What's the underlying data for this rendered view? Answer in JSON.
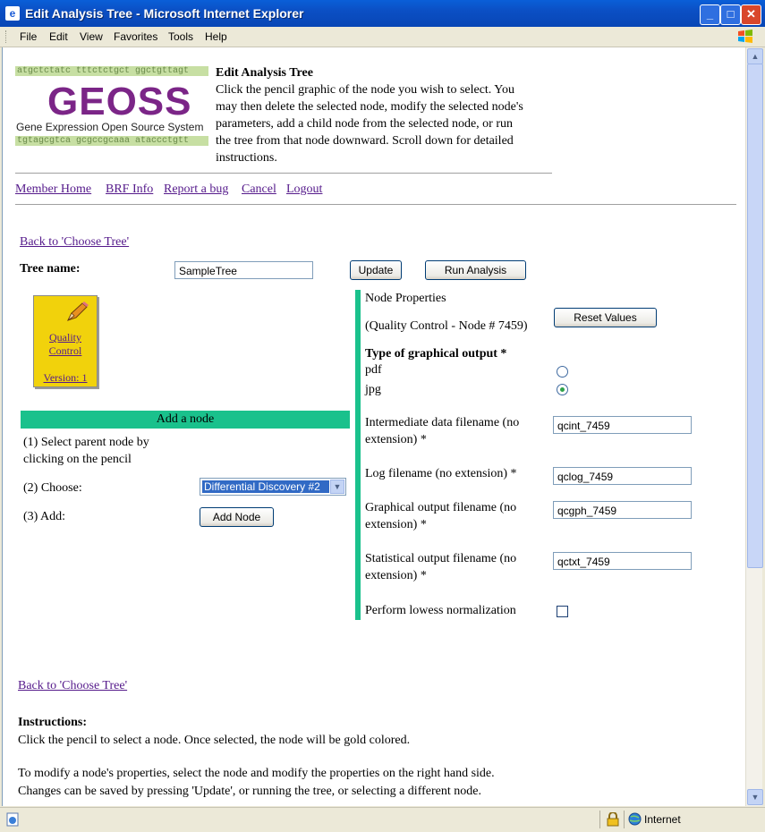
{
  "window": {
    "title": "Edit Analysis Tree - Microsoft Internet Explorer",
    "menu": [
      "File",
      "Edit",
      "View",
      "Favorites",
      "Tools",
      "Help"
    ]
  },
  "header": {
    "seq_top": "atgctctatc tttctctgct ggctgttagt",
    "logo": "GEOSS",
    "logo_sub": "Gene Expression Open Source System",
    "seq_bottom": "tgtagcgtca gcgccgcaaa ataccctgtt",
    "intro_title": "Edit Analysis Tree",
    "intro_lines": [
      "Click the pencil graphic of the node you wish to select. You",
      "may then delete the selected node, modify the selected node's",
      "parameters, add a child node from the selected node, or run",
      "the tree from that node downward. Scroll down for detailed",
      "instructions."
    ]
  },
  "nav": [
    "Member Home",
    "BRF Info",
    "Report a bug",
    "Cancel",
    "Logout"
  ],
  "back_link": "Back to 'Choose Tree'",
  "tree": {
    "name_label": "Tree name:",
    "name_value": "SampleTree",
    "update_label": "Update",
    "run_label": "Run Analysis"
  },
  "node": {
    "line1": "Quality",
    "line2": "Control",
    "version": "Version: 1"
  },
  "add_node": {
    "title": "Add a node",
    "step1a": "(1) Select parent node by",
    "step1b": "clicking on the pencil",
    "step2": "(2) Choose:",
    "choose_value": "Differential Discovery #2",
    "step3": "(3) Add:",
    "add_button": "Add Node"
  },
  "props": {
    "heading": "Node Properties",
    "subheading": "(Quality Control - Node # 7459)",
    "reset_label": "Reset Values",
    "output_type_label": "Type of graphical output *",
    "pdf_label": "pdf",
    "jpg_label": "jpg",
    "intermediate_label_1": "Intermediate data filename (no",
    "intermediate_label_2": "extension) *",
    "intermediate_value": "qcint_7459",
    "log_label": "Log filename (no extension) *",
    "log_value": "qclog_7459",
    "graph_label_1": "Graphical output filename (no",
    "graph_label_2": "extension) *",
    "graph_value": "qcgph_7459",
    "stat_label_1": "Statistical output filename (no",
    "stat_label_2": "extension) *",
    "stat_value": "qctxt_7459",
    "lowess_label": "Perform lowess normalization"
  },
  "instructions": {
    "title": "Instructions:",
    "line1": "Click the pencil to select a node. Once selected, the node will be gold colored.",
    "line2": "To modify a node's properties, select the node and modify the properties on the right hand side.",
    "line3": "Changes can be saved by pressing 'Update', or running the tree, or selecting a different node."
  },
  "status": {
    "zone": "Internet"
  }
}
